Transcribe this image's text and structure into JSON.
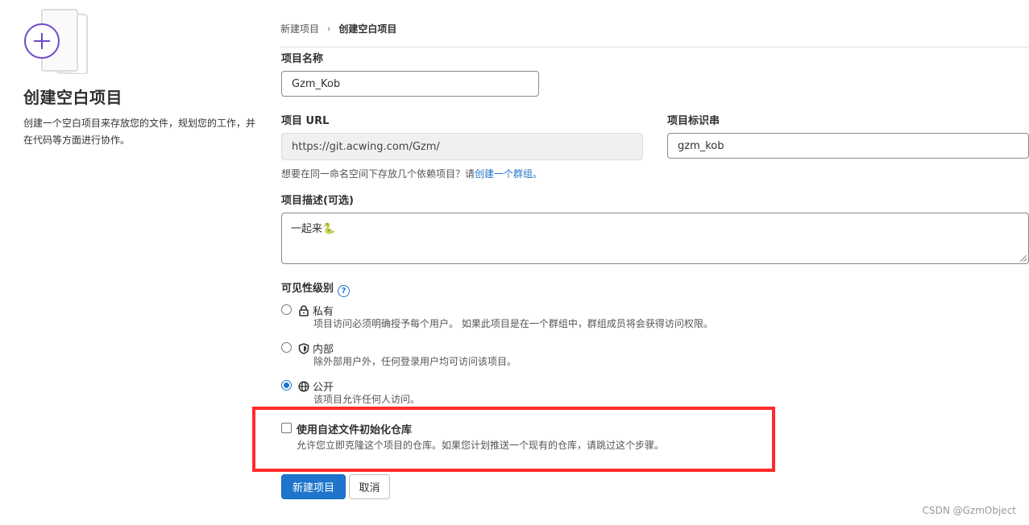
{
  "left_panel": {
    "title": "创建空白项目",
    "description": "创建一个空白项目来存放您的文件，规划您的工作，并在代码等方面进行协作。"
  },
  "breadcrumb": {
    "items": [
      "新建项目",
      "创建空白项目"
    ]
  },
  "form": {
    "project_name": {
      "label": "项目名称",
      "value": "Gzm_Kob"
    },
    "project_url": {
      "label": "项目 URL",
      "value": "https://git.acwing.com/Gzm/"
    },
    "project_slug": {
      "label": "项目标识串",
      "value": "gzm_kob"
    },
    "namespace_hint": {
      "text": "想要在同一命名空间下存放几个依赖项目？请",
      "link": "创建一个群组。"
    },
    "description": {
      "label": "项目描述(可选)",
      "value": "一起来🐍"
    },
    "visibility": {
      "label": "可见性级别",
      "help_icon": "question-circle-icon",
      "options": [
        {
          "title": "私有",
          "icon": "lock-icon",
          "desc": "项目访问必须明确授予每个用户。 如果此项目是在一个群组中，群组成员将会获得访问权限。",
          "checked": false
        },
        {
          "title": "内部",
          "icon": "shield-icon",
          "desc": "除外部用户外，任何登录用户均可访问该项目。",
          "checked": false
        },
        {
          "title": "公开",
          "icon": "globe-icon",
          "desc": "该项目允许任何人访问。",
          "checked": true
        }
      ]
    },
    "init_readme": {
      "label": "使用自述文件初始化仓库",
      "desc": "允许您立即克隆这个项目的仓库。如果您计划推送一个现有的仓库，请跳过这个步骤。",
      "checked": false
    }
  },
  "buttons": {
    "create": "新建项目",
    "cancel": "取消"
  },
  "watermark": "CSDN @GzmObject",
  "colors": {
    "accent": "#1f75cb",
    "highlight_box": "#ff2a2a",
    "illustration": "#6e49cb"
  }
}
